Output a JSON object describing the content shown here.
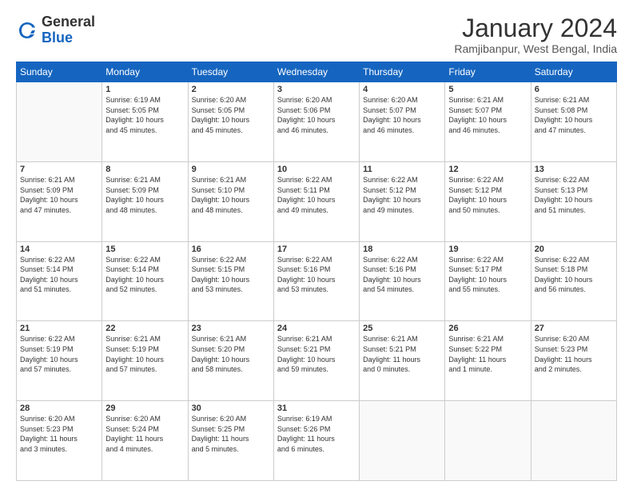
{
  "logo": {
    "general": "General",
    "blue": "Blue"
  },
  "title": "January 2024",
  "subtitle": "Ramjibanpur, West Bengal, India",
  "headers": [
    "Sunday",
    "Monday",
    "Tuesday",
    "Wednesday",
    "Thursday",
    "Friday",
    "Saturday"
  ],
  "weeks": [
    [
      {
        "day": "",
        "info": ""
      },
      {
        "day": "1",
        "info": "Sunrise: 6:19 AM\nSunset: 5:05 PM\nDaylight: 10 hours\nand 45 minutes."
      },
      {
        "day": "2",
        "info": "Sunrise: 6:20 AM\nSunset: 5:05 PM\nDaylight: 10 hours\nand 45 minutes."
      },
      {
        "day": "3",
        "info": "Sunrise: 6:20 AM\nSunset: 5:06 PM\nDaylight: 10 hours\nand 46 minutes."
      },
      {
        "day": "4",
        "info": "Sunrise: 6:20 AM\nSunset: 5:07 PM\nDaylight: 10 hours\nand 46 minutes."
      },
      {
        "day": "5",
        "info": "Sunrise: 6:21 AM\nSunset: 5:07 PM\nDaylight: 10 hours\nand 46 minutes."
      },
      {
        "day": "6",
        "info": "Sunrise: 6:21 AM\nSunset: 5:08 PM\nDaylight: 10 hours\nand 47 minutes."
      }
    ],
    [
      {
        "day": "7",
        "info": "Sunrise: 6:21 AM\nSunset: 5:09 PM\nDaylight: 10 hours\nand 47 minutes."
      },
      {
        "day": "8",
        "info": "Sunrise: 6:21 AM\nSunset: 5:09 PM\nDaylight: 10 hours\nand 48 minutes."
      },
      {
        "day": "9",
        "info": "Sunrise: 6:21 AM\nSunset: 5:10 PM\nDaylight: 10 hours\nand 48 minutes."
      },
      {
        "day": "10",
        "info": "Sunrise: 6:22 AM\nSunset: 5:11 PM\nDaylight: 10 hours\nand 49 minutes."
      },
      {
        "day": "11",
        "info": "Sunrise: 6:22 AM\nSunset: 5:12 PM\nDaylight: 10 hours\nand 49 minutes."
      },
      {
        "day": "12",
        "info": "Sunrise: 6:22 AM\nSunset: 5:12 PM\nDaylight: 10 hours\nand 50 minutes."
      },
      {
        "day": "13",
        "info": "Sunrise: 6:22 AM\nSunset: 5:13 PM\nDaylight: 10 hours\nand 51 minutes."
      }
    ],
    [
      {
        "day": "14",
        "info": "Sunrise: 6:22 AM\nSunset: 5:14 PM\nDaylight: 10 hours\nand 51 minutes."
      },
      {
        "day": "15",
        "info": "Sunrise: 6:22 AM\nSunset: 5:14 PM\nDaylight: 10 hours\nand 52 minutes."
      },
      {
        "day": "16",
        "info": "Sunrise: 6:22 AM\nSunset: 5:15 PM\nDaylight: 10 hours\nand 53 minutes."
      },
      {
        "day": "17",
        "info": "Sunrise: 6:22 AM\nSunset: 5:16 PM\nDaylight: 10 hours\nand 53 minutes."
      },
      {
        "day": "18",
        "info": "Sunrise: 6:22 AM\nSunset: 5:16 PM\nDaylight: 10 hours\nand 54 minutes."
      },
      {
        "day": "19",
        "info": "Sunrise: 6:22 AM\nSunset: 5:17 PM\nDaylight: 10 hours\nand 55 minutes."
      },
      {
        "day": "20",
        "info": "Sunrise: 6:22 AM\nSunset: 5:18 PM\nDaylight: 10 hours\nand 56 minutes."
      }
    ],
    [
      {
        "day": "21",
        "info": "Sunrise: 6:22 AM\nSunset: 5:19 PM\nDaylight: 10 hours\nand 57 minutes."
      },
      {
        "day": "22",
        "info": "Sunrise: 6:21 AM\nSunset: 5:19 PM\nDaylight: 10 hours\nand 57 minutes."
      },
      {
        "day": "23",
        "info": "Sunrise: 6:21 AM\nSunset: 5:20 PM\nDaylight: 10 hours\nand 58 minutes."
      },
      {
        "day": "24",
        "info": "Sunrise: 6:21 AM\nSunset: 5:21 PM\nDaylight: 10 hours\nand 59 minutes."
      },
      {
        "day": "25",
        "info": "Sunrise: 6:21 AM\nSunset: 5:21 PM\nDaylight: 11 hours\nand 0 minutes."
      },
      {
        "day": "26",
        "info": "Sunrise: 6:21 AM\nSunset: 5:22 PM\nDaylight: 11 hours\nand 1 minute."
      },
      {
        "day": "27",
        "info": "Sunrise: 6:20 AM\nSunset: 5:23 PM\nDaylight: 11 hours\nand 2 minutes."
      }
    ],
    [
      {
        "day": "28",
        "info": "Sunrise: 6:20 AM\nSunset: 5:23 PM\nDaylight: 11 hours\nand 3 minutes."
      },
      {
        "day": "29",
        "info": "Sunrise: 6:20 AM\nSunset: 5:24 PM\nDaylight: 11 hours\nand 4 minutes."
      },
      {
        "day": "30",
        "info": "Sunrise: 6:20 AM\nSunset: 5:25 PM\nDaylight: 11 hours\nand 5 minutes."
      },
      {
        "day": "31",
        "info": "Sunrise: 6:19 AM\nSunset: 5:26 PM\nDaylight: 11 hours\nand 6 minutes."
      },
      {
        "day": "",
        "info": ""
      },
      {
        "day": "",
        "info": ""
      },
      {
        "day": "",
        "info": ""
      }
    ]
  ]
}
